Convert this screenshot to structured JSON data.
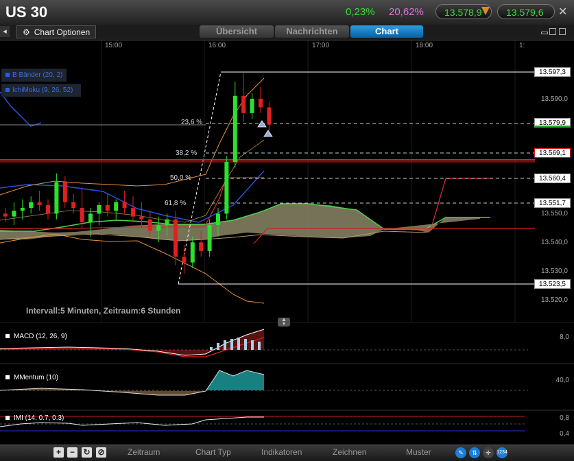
{
  "header": {
    "symbol": "US 30",
    "change_abs_pct": "0,23%",
    "change_pct": "20,62%",
    "bid": "13.578,9",
    "ask": "13.579,6"
  },
  "toolbar": {
    "options_label": "Chart Optionen",
    "tabs": [
      "Übersicht",
      "Nachrichten",
      "Chart"
    ],
    "active_tab": "Chart"
  },
  "legend": {
    "bb": "B Bänder (20, 2)",
    "ichimoku": "IchiMoku (9, 26, 52)"
  },
  "time_axis": [
    "15:00",
    "16:00",
    "17:00",
    "18:00",
    "1:"
  ],
  "price_axis": [
    "13.590,0",
    "13.550,0",
    "13.540,0",
    "13.530,0",
    "13.520,0"
  ],
  "price_labels": [
    "13.597,3",
    "13.579,9",
    "13.569,1",
    "13.560,4",
    "13.551,7",
    "13.523,5"
  ],
  "fib": [
    "23,6 %",
    "38,2 %",
    "50,0 %",
    "61,8 %"
  ],
  "info": "Intervall:5 Minuten, Zeitraum:6 Stunden",
  "indicators": {
    "macd": {
      "label": "MACD (12, 26, 9)",
      "value": "8,0"
    },
    "momentum": {
      "label": "MMentum (10)",
      "value": "40,0"
    },
    "imi": {
      "label": "IMI (14, 0.7, 0.3)",
      "values": [
        "0,8",
        "0,4"
      ]
    }
  },
  "bottom": {
    "tabs": [
      "Zeitraum",
      "Chart Typ",
      "Indikatoren",
      "Zeichnen",
      "Muster"
    ],
    "badge": "1234"
  },
  "chart_data": {
    "type": "candlestick",
    "series": [
      {
        "name": "US 30",
        "ohlc": [
          [
            13548,
            13550,
            13545,
            13547
          ],
          [
            13547,
            13552,
            13544,
            13549
          ],
          [
            13549,
            13553,
            13546,
            13550
          ],
          [
            13550,
            13554,
            13548,
            13552
          ],
          [
            13552,
            13556,
            13549,
            13551
          ],
          [
            13551,
            13553,
            13546,
            13548
          ],
          [
            13548,
            13562,
            13546,
            13559
          ],
          [
            13559,
            13561,
            13550,
            13552
          ],
          [
            13552,
            13555,
            13548,
            13550
          ],
          [
            13550,
            13557,
            13543,
            13545
          ],
          [
            13545,
            13550,
            13540,
            13548
          ],
          [
            13548,
            13552,
            13544,
            13551
          ],
          [
            13551,
            13555,
            13547,
            13549
          ],
          [
            13549,
            13553,
            13546,
            13552
          ],
          [
            13552,
            13556,
            13548,
            13550
          ],
          [
            13550,
            13554,
            13545,
            13547
          ],
          [
            13547,
            13552,
            13543,
            13546
          ],
          [
            13546,
            13549,
            13540,
            13542
          ],
          [
            13542,
            13547,
            13538,
            13544
          ],
          [
            13544,
            13548,
            13540,
            13546
          ],
          [
            13546,
            13549,
            13530,
            13533
          ],
          [
            13533,
            13537,
            13527,
            13531
          ],
          [
            13531,
            13540,
            13529,
            13538
          ],
          [
            13538,
            13542,
            13533,
            13535
          ],
          [
            13535,
            13546,
            13533,
            13544
          ],
          [
            13544,
            13550,
            13540,
            13548
          ],
          [
            13548,
            13568,
            13546,
            13566
          ],
          [
            13566,
            13594,
            13564,
            13589
          ],
          [
            13589,
            13597,
            13580,
            13583
          ],
          [
            13583,
            13590,
            13581,
            13588
          ],
          [
            13588,
            13592,
            13583,
            13585
          ],
          [
            13585,
            13587,
            13577,
            13579
          ]
        ]
      }
    ]
  }
}
